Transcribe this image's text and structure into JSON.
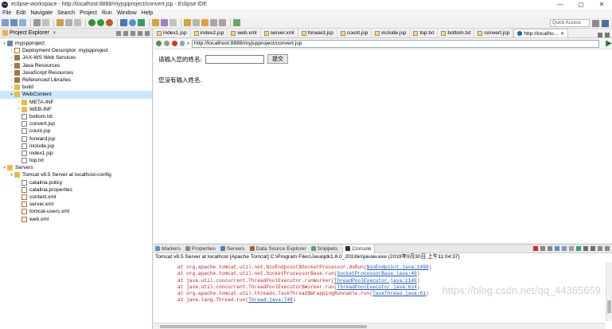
{
  "window": {
    "title": "eclipse-workspace - http://localhost:8888/myjspproject/convert.jsp - Eclipse IDE",
    "minimize": "—",
    "maximize": "▢",
    "close": "✕"
  },
  "menu": [
    "File",
    "Edit",
    "Navigate",
    "Search",
    "Project",
    "Run",
    "Window",
    "Help"
  ],
  "quick_access": "Quick Access",
  "explorer": {
    "title": "Project Explorer",
    "tree": [
      {
        "label": "myjspproject",
        "indent": 0,
        "arrow": "▾",
        "icon": "project"
      },
      {
        "label": "Deployment Descriptor: myjspproject",
        "indent": 1,
        "arrow": "›",
        "icon": "xml"
      },
      {
        "label": "JAX-WS Web Services",
        "indent": 1,
        "arrow": "›",
        "icon": "lib"
      },
      {
        "label": "Java Resources",
        "indent": 1,
        "arrow": "›",
        "icon": "lib"
      },
      {
        "label": "JavaScript Resources",
        "indent": 1,
        "arrow": "›",
        "icon": "lib"
      },
      {
        "label": "Referenced Libraries",
        "indent": 1,
        "arrow": "›",
        "icon": "lib"
      },
      {
        "label": "build",
        "indent": 1,
        "arrow": "›",
        "icon": "folder"
      },
      {
        "label": "WebContent",
        "indent": 1,
        "arrow": "▾",
        "icon": "folder",
        "selected": true
      },
      {
        "label": "META-INF",
        "indent": 2,
        "arrow": "›",
        "icon": "folder"
      },
      {
        "label": "WEB-INF",
        "indent": 2,
        "arrow": "›",
        "icon": "folder"
      },
      {
        "label": "bottom.txt",
        "indent": 2,
        "arrow": "",
        "icon": "file"
      },
      {
        "label": "convert.jsp",
        "indent": 2,
        "arrow": "",
        "icon": "file"
      },
      {
        "label": "count.jsp",
        "indent": 2,
        "arrow": "",
        "icon": "file"
      },
      {
        "label": "forward.jsp",
        "indent": 2,
        "arrow": "",
        "icon": "file"
      },
      {
        "label": "include.jsp",
        "indent": 2,
        "arrow": "",
        "icon": "file"
      },
      {
        "label": "index1.jsp",
        "indent": 2,
        "arrow": "",
        "icon": "file"
      },
      {
        "label": "top.txt",
        "indent": 2,
        "arrow": "",
        "icon": "file"
      },
      {
        "label": "Servers",
        "indent": 0,
        "arrow": "▾",
        "icon": "folder"
      },
      {
        "label": "Tomcat v8.5 Server at localhost-config",
        "indent": 1,
        "arrow": "▾",
        "icon": "folder"
      },
      {
        "label": "catalina.policy",
        "indent": 2,
        "arrow": "",
        "icon": "file"
      },
      {
        "label": "catalina.properties",
        "indent": 2,
        "arrow": "",
        "icon": "file"
      },
      {
        "label": "context.xml",
        "indent": 2,
        "arrow": "",
        "icon": "xml"
      },
      {
        "label": "server.xml",
        "indent": 2,
        "arrow": "",
        "icon": "xml"
      },
      {
        "label": "tomcat-users.xml",
        "indent": 2,
        "arrow": "",
        "icon": "xml"
      },
      {
        "label": "web.xml",
        "indent": 2,
        "arrow": "",
        "icon": "xml"
      }
    ]
  },
  "editor_tabs": [
    {
      "label": "index1.jsp",
      "active": false
    },
    {
      "label": "index2.jsp",
      "active": false
    },
    {
      "label": "web.xml",
      "active": false
    },
    {
      "label": "server.xml",
      "active": false
    },
    {
      "label": "forward.jsp",
      "active": false
    },
    {
      "label": "count.jsp",
      "active": false
    },
    {
      "label": "include.jsp",
      "active": false
    },
    {
      "label": "top.txt",
      "active": false
    },
    {
      "label": "bottom.txt",
      "active": false
    },
    {
      "label": "convert.jsp",
      "active": false
    },
    {
      "label": "http://localho...",
      "active": true
    }
  ],
  "browser": {
    "url": "http://localhost:8888/myjspproject/convert.jsp",
    "form_label": "请输入您的姓名:",
    "input_value": "",
    "submit_label": "提交",
    "message": "您没有输入姓名."
  },
  "console": {
    "tabs": [
      {
        "label": "Markers",
        "active": false,
        "color": "#6a8fc4"
      },
      {
        "label": "Properties",
        "active": false,
        "color": "#8a8a8a"
      },
      {
        "label": "Servers",
        "active": false,
        "color": "#5b7fa8"
      },
      {
        "label": "Data Source Explorer",
        "active": false,
        "color": "#8e6a3a"
      },
      {
        "label": "Snippets",
        "active": false,
        "color": "#6aa06a"
      },
      {
        "label": "Console",
        "active": true,
        "color": "#333333"
      }
    ],
    "title": "Tomcat v8.5 Server at localhost [Apache Tomcat] C:\\Program Files\\Java\\jdk1.8.0_201\\bin\\javaw.exe (2019年9月30日 上午11:04:37)",
    "lines": [
      {
        "text": "at org.apache.tomcat.util.net.NioEndpoint$SocketProcessor.doRun(",
        "link": "NioEndpoint.java:1498",
        "end": ")"
      },
      {
        "text": "at org.apache.tomcat.util.net.SocketProcessorBase.run(",
        "link": "SocketProcessorBase.java:49",
        "end": ")"
      },
      {
        "text": "at java.util.concurrent.ThreadPoolExecutor.runWorker(",
        "link": "ThreadPoolExecutor.java:1149",
        "end": ")"
      },
      {
        "text": "at java.util.concurrent.ThreadPoolExecutor$Worker.run(",
        "link": "ThreadPoolExecutor.java:624",
        "end": ")"
      },
      {
        "text": "at org.apache.tomcat.util.threads.TaskThread$WrappingRunnable.run(",
        "link": "TaskThread.java:61",
        "end": ")"
      },
      {
        "text": "at java.lang.Thread.run(",
        "link": "Thread.java:748",
        "end": ")"
      }
    ],
    "watermark": "https://blog.csdn.net/qq_44365659"
  }
}
